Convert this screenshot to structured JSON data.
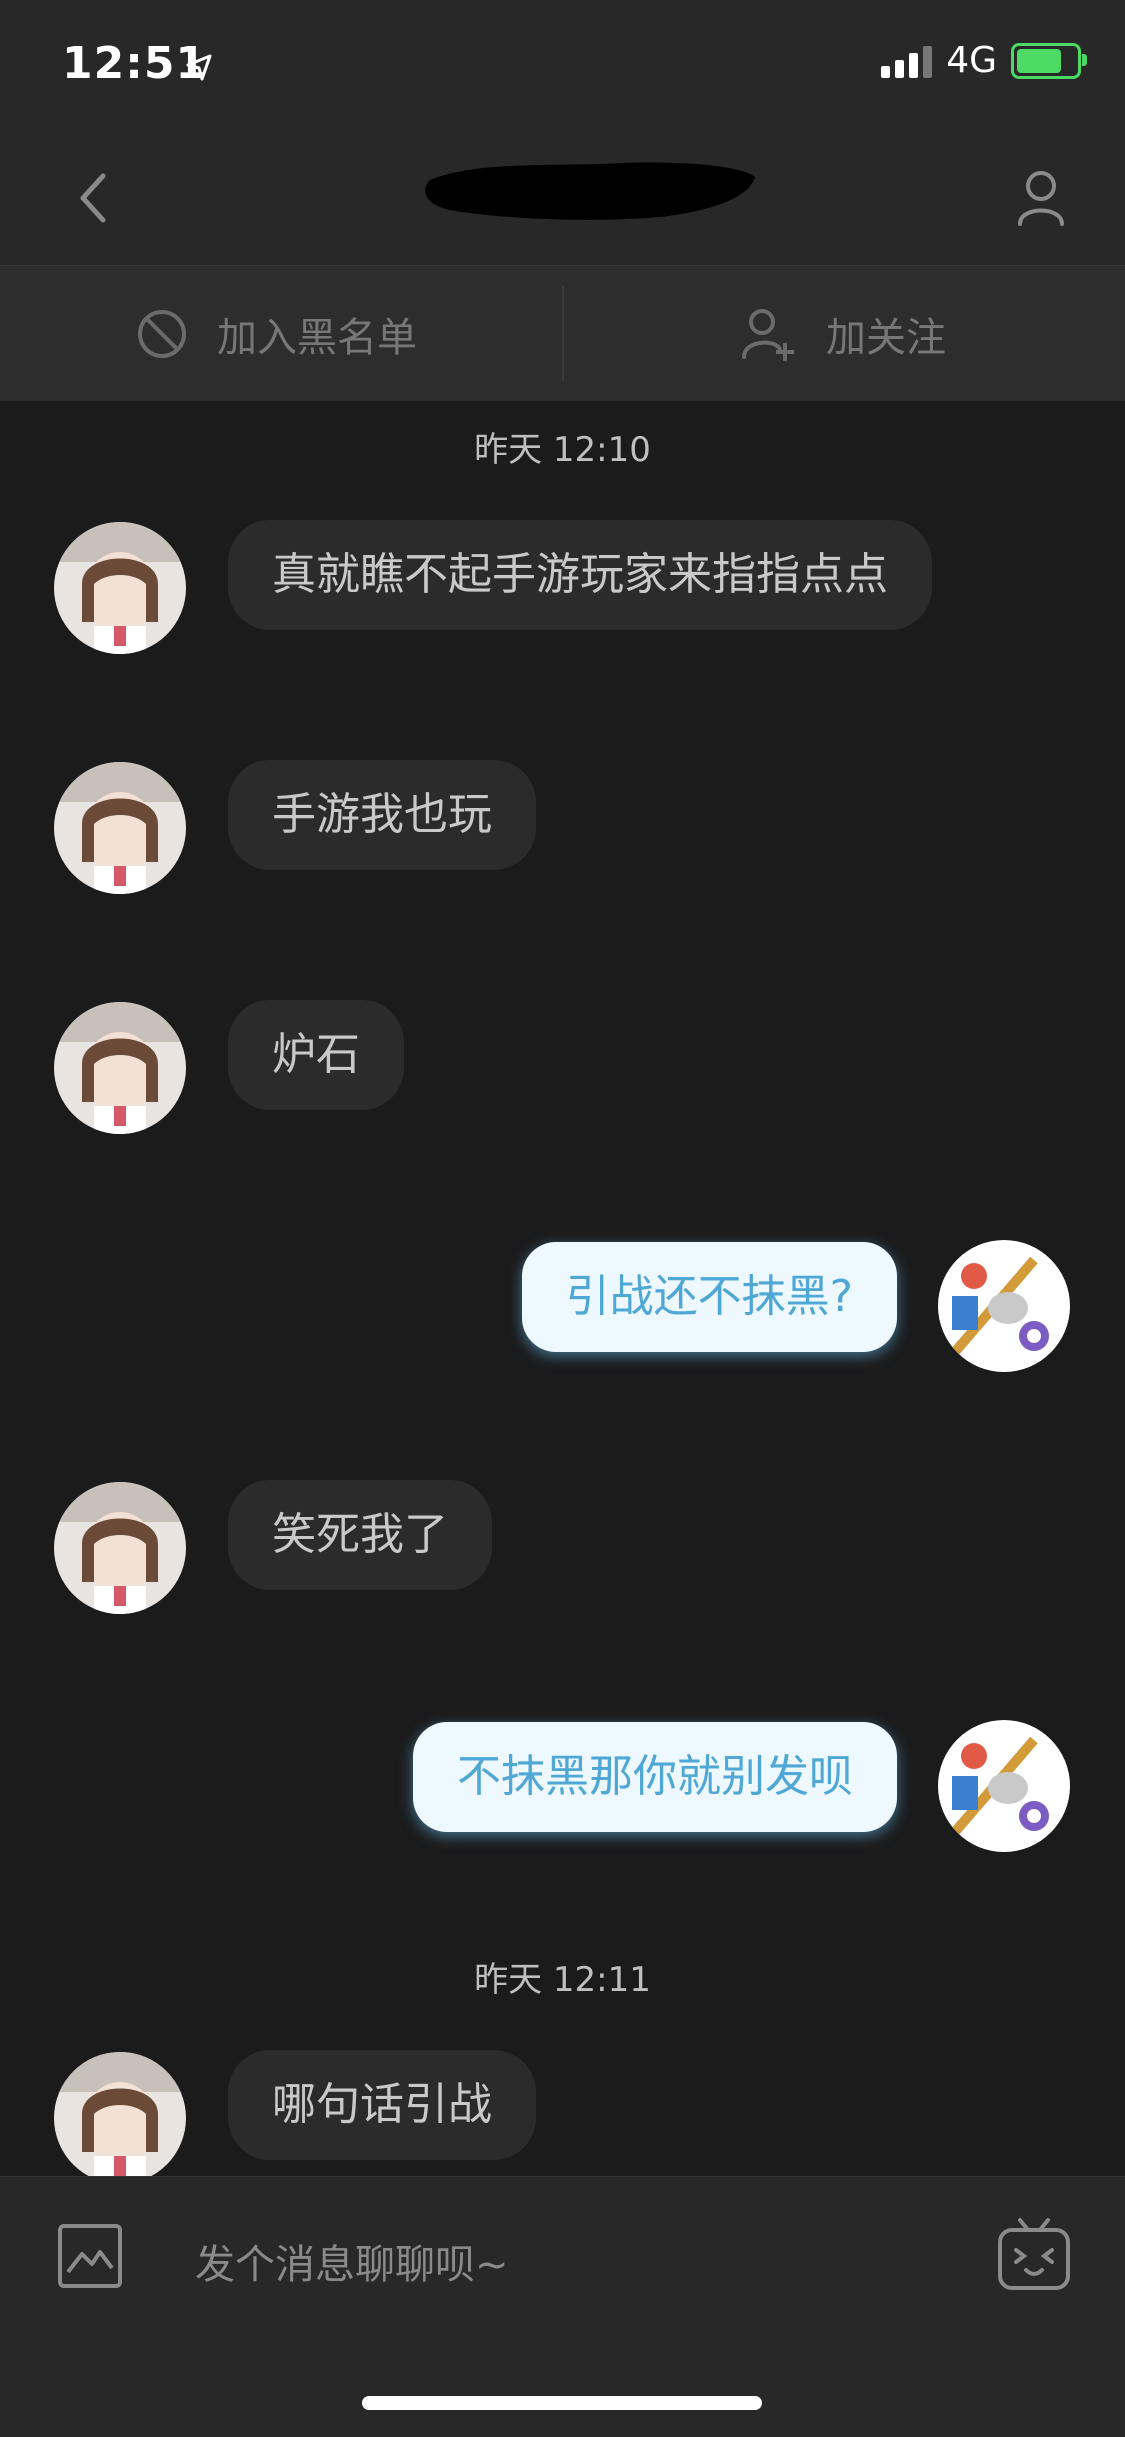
{
  "status": {
    "time": "12:51",
    "network": "4G"
  },
  "toolbar": {
    "blacklist_label": "加入黑名单",
    "follow_label": "加关注"
  },
  "messages": [
    {
      "type": "time",
      "text": "昨天 12:10"
    },
    {
      "type": "in",
      "text": "真就瞧不起手游玩家来指指点点"
    },
    {
      "type": "in",
      "text": "手游我也玩"
    },
    {
      "type": "in",
      "text": "炉石"
    },
    {
      "type": "out",
      "text": "引战还不抹黑?"
    },
    {
      "type": "in",
      "text": "笑死我了"
    },
    {
      "type": "out",
      "text": "不抹黑那你就别发呗"
    },
    {
      "type": "time",
      "text": "昨天 12:11"
    },
    {
      "type": "in",
      "text": "哪句话引战"
    }
  ],
  "input": {
    "placeholder": "发个消息聊聊呗~"
  },
  "colors": {
    "background": "#1b1b1c",
    "bar": "#282829",
    "out_bubble": "#eef8ff",
    "out_text": "#4ea7d4"
  }
}
